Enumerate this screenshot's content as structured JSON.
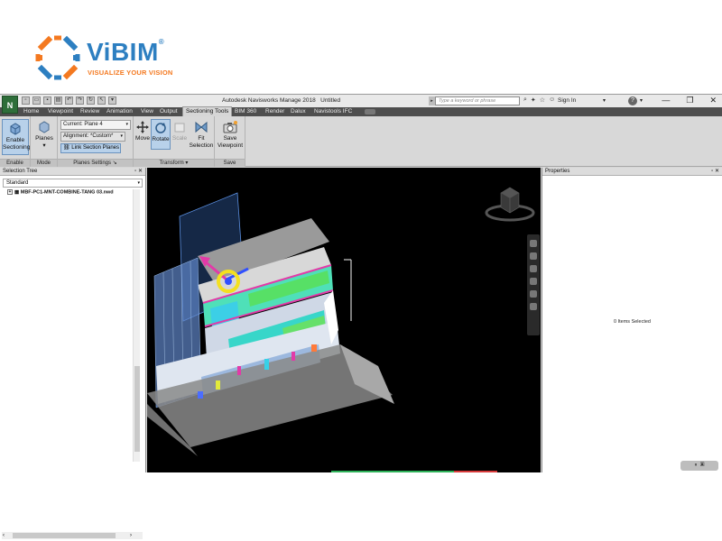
{
  "logo": {
    "name": "ViBIM",
    "reg": "®",
    "tagline": "VISUALIZE YOUR VISION",
    "colors": {
      "blue": "#2d7fc1",
      "orange": "#f47920"
    }
  },
  "app": {
    "icon_letter": "N",
    "title": "Autodesk Navisworks Manage 2018",
    "document": "Untitled",
    "search_placeholder": "Type a keyword or phrase",
    "signin": "Sign In",
    "help": "?",
    "window_buttons": [
      "—",
      "❐",
      "✕"
    ]
  },
  "tabs": [
    "Home",
    "Viewpoint",
    "Review",
    "Animation",
    "View",
    "Output",
    "Sectioning Tools",
    "BIM 360",
    "Render",
    "Dalux",
    "Navistools IFC"
  ],
  "active_tab": "Sectioning Tools",
  "ribbon": {
    "enable": {
      "label_line1": "Enable",
      "label_line2": "Sectioning",
      "group": "Enable"
    },
    "mode": {
      "label": "Planes",
      "group": "Mode"
    },
    "planes_settings": {
      "current_plane": "Current: Plane 4",
      "alignment": "Alignment: *Custom*",
      "link": "Link Section Planes",
      "group": "Planes Settings"
    },
    "transform": {
      "move": "Move",
      "rotate": "Rotate",
      "scale": "Scale",
      "fit_line1": "Fit",
      "fit_line2": "Selection",
      "group": "Transform"
    },
    "save": {
      "label_line1": "Save",
      "label_line2": "Viewpoint",
      "group": "Save"
    }
  },
  "selection_tree": {
    "title": "Selection Tree",
    "filter": "Standard",
    "item": "MBF-PC1-MNT-COMBINE-TANG 03.nwd"
  },
  "properties": {
    "title": "Properties",
    "status": "0 Items Selected"
  }
}
